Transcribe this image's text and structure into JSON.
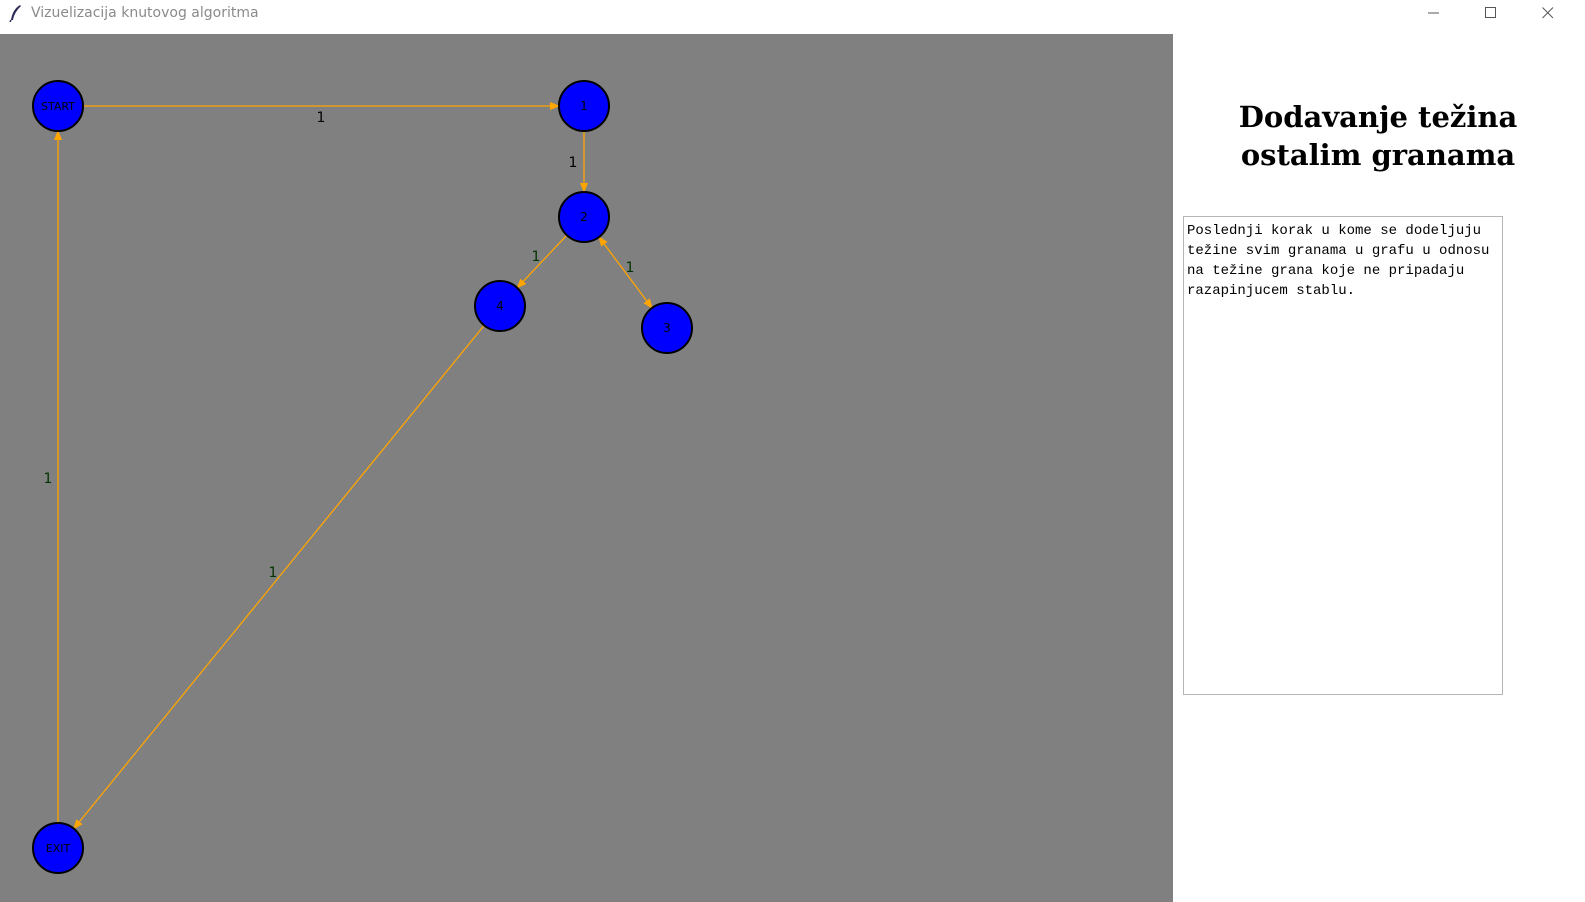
{
  "window": {
    "title": "Vizuelizacija knutovog algoritma",
    "icon": "feather-icon",
    "controls": [
      "minimize-icon",
      "maximize-icon",
      "close-icon"
    ]
  },
  "graph": {
    "background": "#808080",
    "node_color": "#0000ff",
    "edge_color": "#ffa500",
    "nodes": [
      {
        "id": "START",
        "label": "START"
      },
      {
        "id": "1",
        "label": "1"
      },
      {
        "id": "2",
        "label": "2"
      },
      {
        "id": "3",
        "label": "3"
      },
      {
        "id": "4",
        "label": "4"
      },
      {
        "id": "EXIT",
        "label": "EXIT"
      }
    ],
    "edges": [
      {
        "from": "START",
        "to": "1",
        "weight": "1",
        "weight_color": "#000000"
      },
      {
        "from": "1",
        "to": "2",
        "weight": "1",
        "weight_color": "#000000"
      },
      {
        "from": "2",
        "to": "4",
        "weight": "1",
        "weight_color": "#003300"
      },
      {
        "from": "2",
        "to": "3",
        "weight": "1",
        "weight_color": "#003300",
        "bidirectional": true
      },
      {
        "from": "4",
        "to": "EXIT",
        "weight": "1",
        "weight_color": "#003300"
      },
      {
        "from": "EXIT",
        "to": "START",
        "weight": "1",
        "weight_color": "#003300"
      }
    ]
  },
  "panel": {
    "title": "Dodavanje težina ostalim granama",
    "description": "Poslednji korak u kome se dodeljuju težine svim granama u grafu u odnosu na težine grana koje ne pripadaju razapinjucem stablu."
  }
}
